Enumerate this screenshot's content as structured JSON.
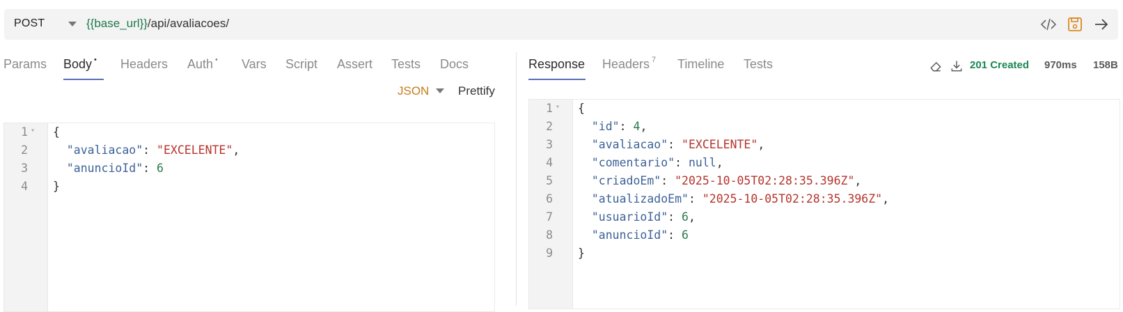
{
  "request": {
    "method": "POST",
    "url_var": "{{base_url}}",
    "url_path": "/api/avaliacoes/"
  },
  "request_tabs": [
    {
      "label": "Params",
      "badge": ""
    },
    {
      "label": "Body",
      "badge": "•"
    },
    {
      "label": "Headers",
      "badge": ""
    },
    {
      "label": "Auth",
      "badge": "•"
    },
    {
      "label": "Vars",
      "badge": ""
    },
    {
      "label": "Script",
      "badge": ""
    },
    {
      "label": "Assert",
      "badge": ""
    },
    {
      "label": "Tests",
      "badge": ""
    },
    {
      "label": "Docs",
      "badge": ""
    }
  ],
  "body_toolbar": {
    "format": "JSON",
    "prettify": "Prettify"
  },
  "request_body": {
    "line_numbers": [
      "1",
      "2",
      "3",
      "4"
    ],
    "lines": [
      [
        {
          "t": "p",
          "v": "{"
        }
      ],
      [
        {
          "t": "p",
          "v": "  "
        },
        {
          "t": "k",
          "v": "\"avaliacao\""
        },
        {
          "t": "p",
          "v": ": "
        },
        {
          "t": "s",
          "v": "\"EXCELENTE\""
        },
        {
          "t": "p",
          "v": ","
        }
      ],
      [
        {
          "t": "p",
          "v": "  "
        },
        {
          "t": "k",
          "v": "\"anuncioId\""
        },
        {
          "t": "p",
          "v": ": "
        },
        {
          "t": "n",
          "v": "6"
        }
      ],
      [
        {
          "t": "p",
          "v": "}"
        }
      ]
    ]
  },
  "response_tabs": [
    {
      "label": "Response",
      "badge": ""
    },
    {
      "label": "Headers",
      "badge": "7"
    },
    {
      "label": "Timeline",
      "badge": ""
    },
    {
      "label": "Tests",
      "badge": ""
    }
  ],
  "response_status": {
    "code": "201 Created",
    "time": "970ms",
    "size": "158B"
  },
  "response_body": {
    "line_numbers": [
      "1",
      "2",
      "3",
      "4",
      "5",
      "6",
      "7",
      "8",
      "9"
    ],
    "lines": [
      [
        {
          "t": "p",
          "v": "{"
        }
      ],
      [
        {
          "t": "p",
          "v": "  "
        },
        {
          "t": "k",
          "v": "\"id\""
        },
        {
          "t": "p",
          "v": ": "
        },
        {
          "t": "n",
          "v": "4"
        },
        {
          "t": "p",
          "v": ","
        }
      ],
      [
        {
          "t": "p",
          "v": "  "
        },
        {
          "t": "k",
          "v": "\"avaliacao\""
        },
        {
          "t": "p",
          "v": ": "
        },
        {
          "t": "s",
          "v": "\"EXCELENTE\""
        },
        {
          "t": "p",
          "v": ","
        }
      ],
      [
        {
          "t": "p",
          "v": "  "
        },
        {
          "t": "k",
          "v": "\"comentario\""
        },
        {
          "t": "p",
          "v": ": "
        },
        {
          "t": "null",
          "v": "null"
        },
        {
          "t": "p",
          "v": ","
        }
      ],
      [
        {
          "t": "p",
          "v": "  "
        },
        {
          "t": "k",
          "v": "\"criadoEm\""
        },
        {
          "t": "p",
          "v": ": "
        },
        {
          "t": "s",
          "v": "\"2025-10-05T02:28:35.396Z\""
        },
        {
          "t": "p",
          "v": ","
        }
      ],
      [
        {
          "t": "p",
          "v": "  "
        },
        {
          "t": "k",
          "v": "\"atualizadoEm\""
        },
        {
          "t": "p",
          "v": ": "
        },
        {
          "t": "s",
          "v": "\"2025-10-05T02:28:35.396Z\""
        },
        {
          "t": "p",
          "v": ","
        }
      ],
      [
        {
          "t": "p",
          "v": "  "
        },
        {
          "t": "k",
          "v": "\"usuarioId\""
        },
        {
          "t": "p",
          "v": ": "
        },
        {
          "t": "n",
          "v": "6"
        },
        {
          "t": "p",
          "v": ","
        }
      ],
      [
        {
          "t": "p",
          "v": "  "
        },
        {
          "t": "k",
          "v": "\"anuncioId\""
        },
        {
          "t": "p",
          "v": ": "
        },
        {
          "t": "n",
          "v": "6"
        }
      ],
      [
        {
          "t": "p",
          "v": "}"
        }
      ]
    ]
  },
  "icons": {
    "code": "code-icon",
    "save": "save-icon",
    "send": "arrow-right-icon",
    "clear": "eraser-icon",
    "download": "download-icon"
  },
  "colors": {
    "accent": "#546fb4",
    "success": "#1c8754",
    "save_icon": "#d9891f",
    "json_label": "#c77a18"
  }
}
